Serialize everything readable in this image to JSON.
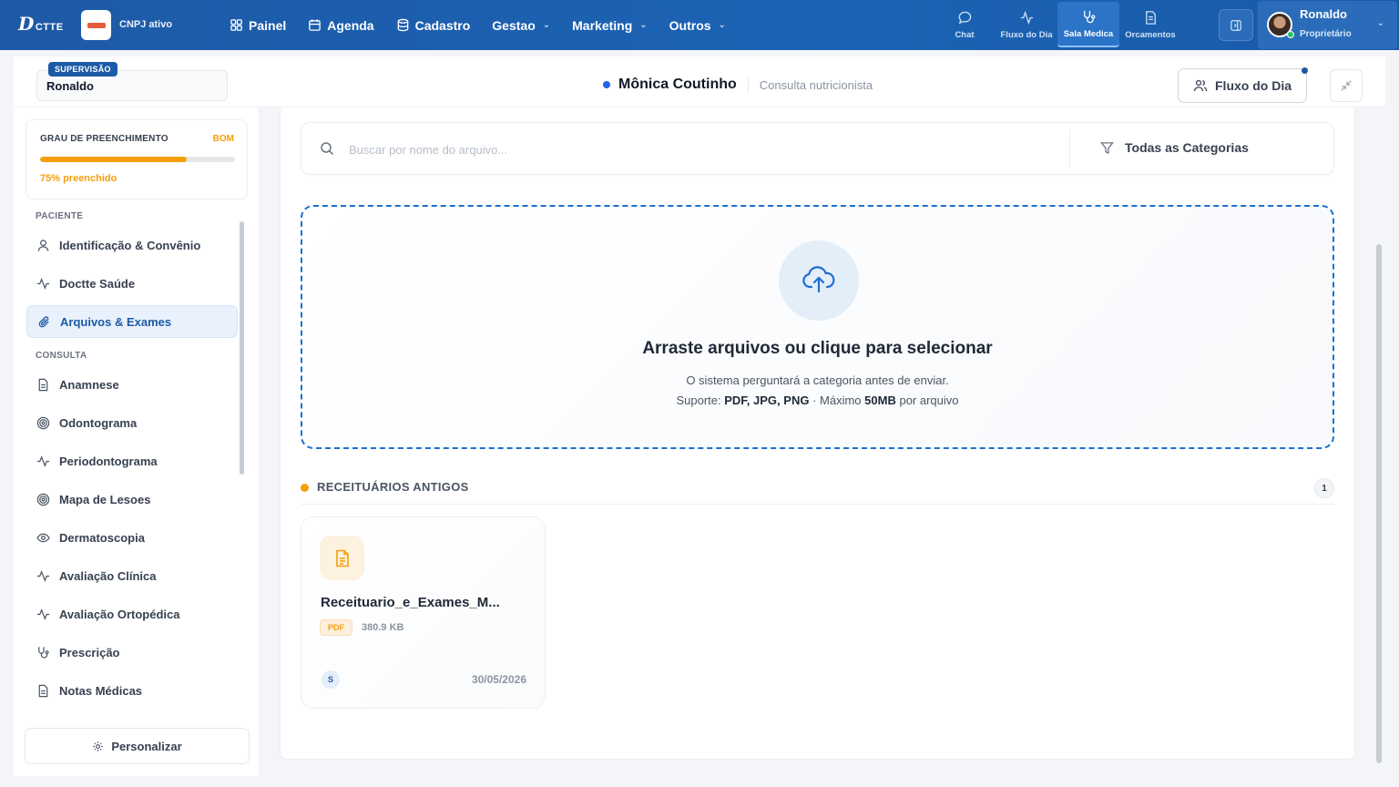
{
  "topbar": {
    "logo_text": "D",
    "logo_suffix": "CTTE",
    "cnpj_label": "CNPJ ativo",
    "nav": [
      {
        "label": "Painel",
        "icon": "grid-icon"
      },
      {
        "label": "Agenda",
        "icon": "calendar-icon"
      },
      {
        "label": "Cadastro",
        "icon": "database-icon"
      },
      {
        "label": "Gestao",
        "icon": "chevron-down-icon"
      },
      {
        "label": "Marketing",
        "icon": "chevron-down-icon"
      },
      {
        "label": "Outros",
        "icon": "chevron-down-icon"
      }
    ],
    "quick": [
      {
        "label": "Chat",
        "icon": "chat-icon"
      },
      {
        "label": "Fluxo do Dia",
        "icon": "activity-icon"
      },
      {
        "label": "Sala Medica",
        "icon": "stethoscope-icon",
        "active": true
      },
      {
        "label": "Orcamentos",
        "icon": "document-icon"
      }
    ],
    "user": {
      "name": "Ronaldo",
      "role": "Proprietário"
    }
  },
  "subheader": {
    "supervision_badge": "SUPERVISÃO",
    "supervision_name": "Ronaldo",
    "patient_name": "Mônica Coutinho",
    "consult_type": "Consulta nutricionista",
    "fluxo_button": "Fluxo do Dia"
  },
  "sidebar": {
    "fill": {
      "title": "GRAU DE PREENCHIMENTO",
      "badge": "BOM",
      "percent": 75,
      "percent_label": "75% preenchido"
    },
    "sections": [
      {
        "label": "PACIENTE"
      },
      {
        "label": "CONSULTA"
      }
    ],
    "items": [
      {
        "label": "Identificação & Convênio",
        "icon": "user-icon"
      },
      {
        "label": "Doctte Saúde",
        "icon": "activity-icon"
      },
      {
        "label": "Arquivos & Exames",
        "icon": "paperclip-icon",
        "active": true
      },
      {
        "label": "Anamnese",
        "icon": "document-icon"
      },
      {
        "label": "Odontograma",
        "icon": "target-icon"
      },
      {
        "label": "Periodontograma",
        "icon": "activity-icon"
      },
      {
        "label": "Mapa de Lesoes",
        "icon": "target-icon"
      },
      {
        "label": "Dermatoscopia",
        "icon": "eye-icon"
      },
      {
        "label": "Avaliação Clínica",
        "icon": "activity-icon"
      },
      {
        "label": "Avaliação Ortopédica",
        "icon": "activity-icon"
      },
      {
        "label": "Prescrição",
        "icon": "stethoscope-icon"
      },
      {
        "label": "Notas Médicas",
        "icon": "document-icon"
      }
    ],
    "personalize": "Personalizar"
  },
  "main": {
    "search_placeholder": "Buscar por nome do arquivo...",
    "category_filter": "Todas as Categorias",
    "dropzone": {
      "title": "Arraste arquivos ou clique para selecionar",
      "subtitle": "O sistema perguntará a categoria antes de enviar.",
      "support_prefix": "Suporte:",
      "support_formats": "PDF, JPG, PNG",
      "support_mid": "· Máximo",
      "support_size": "50MB",
      "support_suffix": "por arquivo"
    },
    "section": {
      "title": "RECEITUÁRIOS ANTIGOS",
      "count": "1",
      "accent": "#f59e0b"
    },
    "files": [
      {
        "name": "Receituario_e_Exames_M...",
        "type": "PDF",
        "size": "380.9 KB",
        "user_initial": "S",
        "date": "30/05/2026"
      }
    ]
  },
  "colors": {
    "primary": "#1d5aa6",
    "accent": "#f59e0b",
    "dropzone_border": "#1d6fd1"
  }
}
